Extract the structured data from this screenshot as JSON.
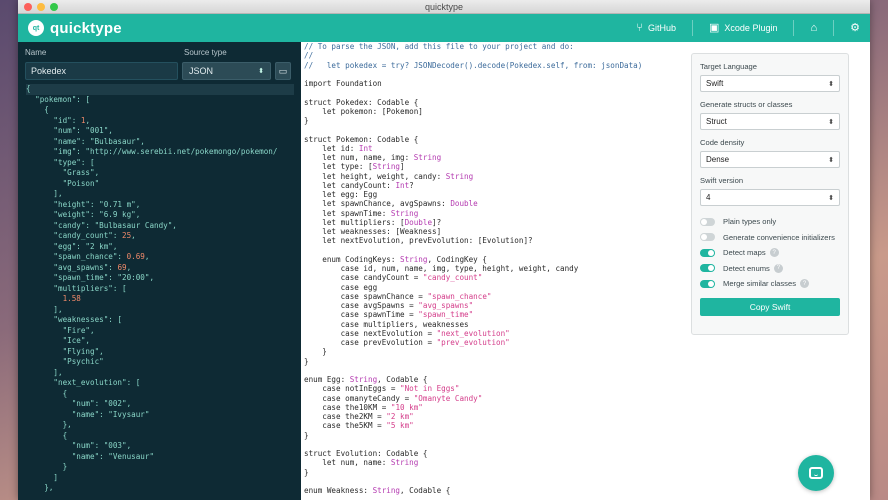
{
  "window": {
    "title": "quicktype"
  },
  "header": {
    "logo_mark": "qt",
    "app_name": "quicktype",
    "github": "GitHub",
    "xcode": "Xcode Plugin"
  },
  "left": {
    "name_label": "Name",
    "source_type_label": "Source type",
    "name_value": "Pokedex",
    "source_type_value": "JSON",
    "json_lines": [
      "{",
      "  \"pokemon\": [",
      "    {",
      "      \"id\": 1,",
      "      \"num\": \"001\",",
      "      \"name\": \"Bulbasaur\",",
      "      \"img\": \"http://www.serebii.net/pokemongo/pokemon/",
      "      \"type\": [",
      "        \"Grass\",",
      "        \"Poison\"",
      "      ],",
      "      \"height\": \"0.71 m\",",
      "      \"weight\": \"6.9 kg\",",
      "      \"candy\": \"Bulbasaur Candy\",",
      "      \"candy_count\": 25,",
      "      \"egg\": \"2 km\",",
      "      \"spawn_chance\": 0.69,",
      "      \"avg_spawns\": 69,",
      "      \"spawn_time\": \"20:00\",",
      "      \"multipliers\": [",
      "        1.58",
      "      ],",
      "      \"weaknesses\": [",
      "        \"Fire\",",
      "        \"Ice\",",
      "        \"Flying\",",
      "        \"Psychic\"",
      "      ],",
      "      \"next_evolution\": [",
      "        {",
      "          \"num\": \"002\",",
      "          \"name\": \"Ivysaur\"",
      "        },",
      "        {",
      "          \"num\": \"003\",",
      "          \"name\": \"Venusaur\"",
      "        }",
      "      ]",
      "    },"
    ]
  },
  "code_lines": [
    "// To parse the JSON, add this file to your project and do:",
    "//",
    "//   let pokedex = try? JSONDecoder().decode(Pokedex.self, from: jsonData)",
    "",
    "import Foundation",
    "",
    "struct Pokedex: Codable {",
    "    let pokemon: [Pokemon]",
    "}",
    "",
    "struct Pokemon: Codable {",
    "    let id: Int",
    "    let num, name, img: String",
    "    let type: [String]",
    "    let height, weight, candy: String",
    "    let candyCount: Int?",
    "    let egg: Egg",
    "    let spawnChance, avgSpawns: Double",
    "    let spawnTime: String",
    "    let multipliers: [Double]?",
    "    let weaknesses: [Weakness]",
    "    let nextEvolution, prevEvolution: [Evolution]?",
    "",
    "    enum CodingKeys: String, CodingKey {",
    "        case id, num, name, img, type, height, weight, candy",
    "        case candyCount = \"candy_count\"",
    "        case egg",
    "        case spawnChance = \"spawn_chance\"",
    "        case avgSpawns = \"avg_spawns\"",
    "        case spawnTime = \"spawn_time\"",
    "        case multipliers, weaknesses",
    "        case nextEvolution = \"next_evolution\"",
    "        case prevEvolution = \"prev_evolution\"",
    "    }",
    "}",
    "",
    "enum Egg: String, Codable {",
    "    case notInEggs = \"Not in Eggs\"",
    "    case omanyteCandy = \"Omanyte Candy\"",
    "    case the10KM = \"10 km\"",
    "    case the2KM = \"2 km\"",
    "    case the5KM = \"5 km\"",
    "}",
    "",
    "struct Evolution: Codable {",
    "    let num, name: String",
    "}",
    "",
    "enum Weakness: String, Codable {"
  ],
  "options": {
    "target_language_label": "Target Language",
    "target_language": "Swift",
    "generate_label": "Generate structs or classes",
    "generate_value": "Struct",
    "density_label": "Code density",
    "density_value": "Dense",
    "swift_version_label": "Swift version",
    "swift_version_value": "4",
    "toggles": [
      {
        "label": "Plain types only",
        "on": false,
        "help": false
      },
      {
        "label": "Generate convenience initializers",
        "on": false,
        "help": false
      },
      {
        "label": "Detect maps",
        "on": true,
        "help": true
      },
      {
        "label": "Detect enums",
        "on": true,
        "help": true
      },
      {
        "label": "Merge similar classes",
        "on": true,
        "help": true
      }
    ],
    "copy_button": "Copy Swift"
  },
  "colors": {
    "accent": "#1fb5a0",
    "sidebar_bg": "#0e2a34"
  }
}
